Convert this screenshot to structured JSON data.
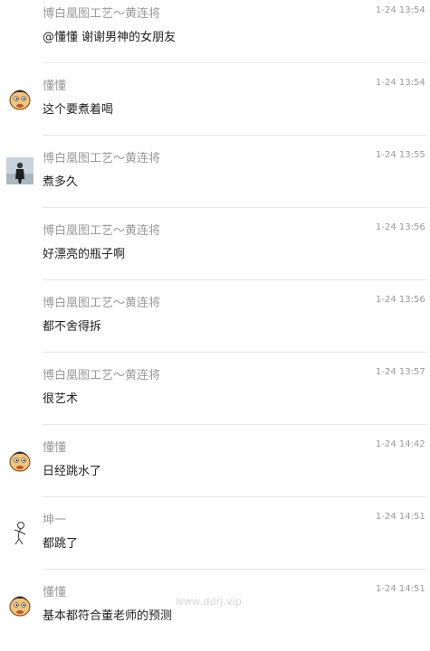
{
  "comments": [
    {
      "name": "博白凰图工艺～黄连将",
      "time": "1-24 13:54",
      "text": "@懂懂 谢谢男神的女朋友",
      "avatar": "none"
    },
    {
      "name": "懂懂",
      "time": "1-24 13:54",
      "text": "这个要煮着喝",
      "avatar": "cartoon-face-icon"
    },
    {
      "name": "博白凰图工艺～黄连将",
      "time": "1-24 13:55",
      "text": "煮多久",
      "avatar": "person-photo-avatar"
    },
    {
      "name": "博白凰图工艺～黄连将",
      "time": "1-24 13:56",
      "text": "好漂亮的瓶子啊",
      "avatar": "none"
    },
    {
      "name": "博白凰图工艺～黄连将",
      "time": "1-24 13:56",
      "text": "都不舍得拆",
      "avatar": "none"
    },
    {
      "name": "博白凰图工艺～黄连将",
      "time": "1-24 13:57",
      "text": "很艺术",
      "avatar": "none"
    },
    {
      "name": "懂懂",
      "time": "1-24 14:42",
      "text": "日经跳水了",
      "avatar": "cartoon-face-icon"
    },
    {
      "name": "坤一",
      "time": "1-24 14:51",
      "text": "都跳了",
      "avatar": "sketch-figure-icon"
    },
    {
      "name": "懂懂",
      "time": "1-24 14:51",
      "text": "基本都符合董老师的预测",
      "avatar": "cartoon-face-icon"
    }
  ],
  "watermark": "www.ddrj.vip"
}
